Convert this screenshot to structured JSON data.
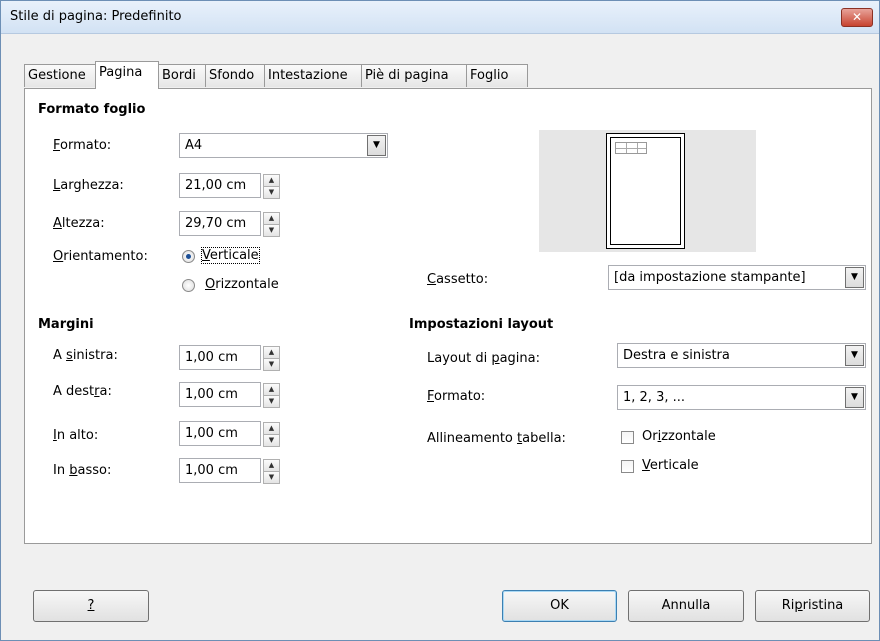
{
  "window": {
    "title": "Stile di pagina: Predefinito",
    "close_glyph": "✕"
  },
  "tabs": [
    {
      "label": "Gestione",
      "active": false
    },
    {
      "label": "Pagina",
      "active": true
    },
    {
      "label": "Bordi",
      "active": false
    },
    {
      "label": "Sfondo",
      "active": false
    },
    {
      "label": "Intestazione",
      "active": false
    },
    {
      "label": "Piè di pagina",
      "active": false
    },
    {
      "label": "Foglio",
      "active": false
    }
  ],
  "paper_format": {
    "heading": "Formato foglio",
    "format_label_u": "F",
    "format_label_rest": "ormato:",
    "format_value": "A4",
    "width_label_u": "L",
    "width_label_rest": "arghezza:",
    "width_value": "21,00 cm",
    "height_label_u": "A",
    "height_label_rest": "ltezza:",
    "height_value": "29,70 cm",
    "orientation_label_u": "O",
    "orientation_label_rest": "rientamento:",
    "portrait_u": "V",
    "portrait_rest": "erticale",
    "portrait_selected": true,
    "landscape_u": "O",
    "landscape_rest": "rizzontale",
    "landscape_selected": false,
    "tray_label_u": "C",
    "tray_label_rest": "assetto:",
    "tray_value": "[da impostazione stampante]"
  },
  "margins": {
    "heading": "Margini",
    "left_pre": "A ",
    "left_u": "s",
    "left_rest": "inistra:",
    "left_value": "1,00 cm",
    "right_pre": "A dest",
    "right_u": "r",
    "right_rest": "a:",
    "right_value": "1,00 cm",
    "top_pre": "",
    "top_u": "I",
    "top_rest": "n alto:",
    "top_value": "1,00 cm",
    "bottom_pre": "In ",
    "bottom_u": "b",
    "bottom_rest": "asso:",
    "bottom_value": "1,00 cm"
  },
  "layout": {
    "heading": "Impostazioni layout",
    "page_layout_pre": "Layout di ",
    "page_layout_u": "p",
    "page_layout_rest": "agina:",
    "page_layout_value": "Destra e sinistra",
    "format_u": "F",
    "format_rest": "ormato:",
    "format_value": "1, 2, 3, ...",
    "table_align_pre": "Allineamento ",
    "table_align_u": "t",
    "table_align_rest": "abella:",
    "horizontal_pre": "Or",
    "horizontal_u": "i",
    "horizontal_rest": "zzontale",
    "horizontal_checked": false,
    "vertical_u": "V",
    "vertical_rest": "erticale",
    "vertical_checked": false
  },
  "buttons": {
    "help_label": "?",
    "ok_label": "OK",
    "cancel_label": "Annulla",
    "reset_pre": "Ri",
    "reset_u": "p",
    "reset_rest": "ristina"
  },
  "icons": {
    "spin_up": "▲",
    "spin_down": "▼",
    "combo_arrow": "▼"
  }
}
